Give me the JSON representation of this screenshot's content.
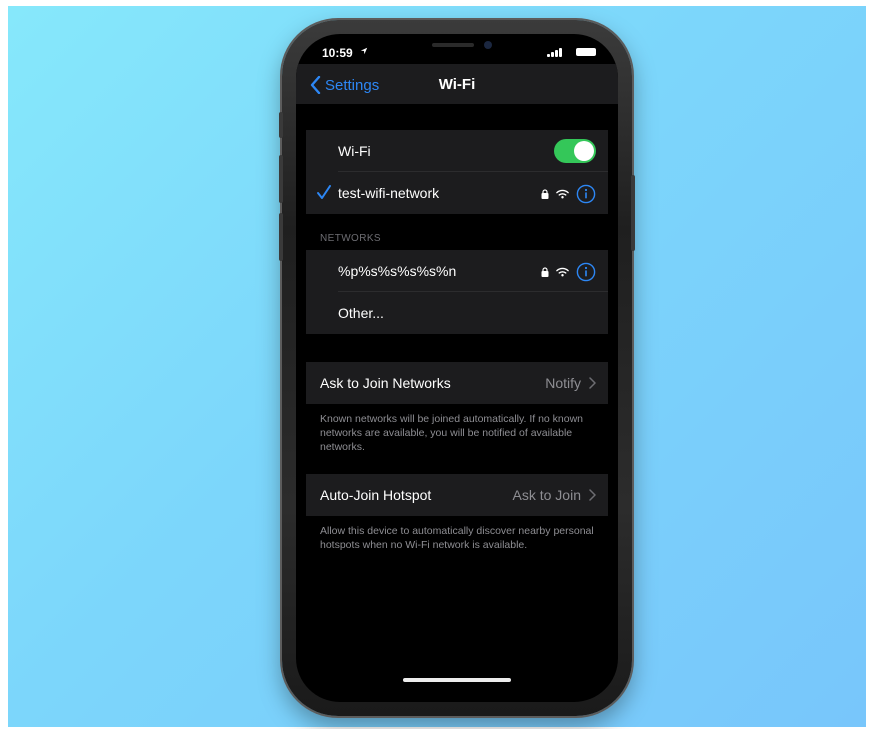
{
  "status": {
    "time": "10:59"
  },
  "nav": {
    "back_label": "Settings",
    "title": "Wi-Fi"
  },
  "wifi": {
    "label": "Wi-Fi",
    "enabled": true,
    "connected_network": "test-wifi-network"
  },
  "networks": {
    "header": "NETWORKS",
    "items": [
      {
        "name": "%p%s%s%s%s%n",
        "secured": true
      },
      {
        "name": "Other..."
      }
    ]
  },
  "ask_to_join": {
    "label": "Ask to Join Networks",
    "value": "Notify",
    "footer": "Known networks will be joined automatically. If no known networks are available, you will be notified of available networks."
  },
  "auto_join": {
    "label": "Auto-Join Hotspot",
    "value": "Ask to Join",
    "footer": "Allow this device to automatically discover nearby personal hotspots when no Wi-Fi network is available."
  },
  "colors": {
    "accent": "#2d87f5",
    "toggle_on": "#34c759",
    "background_gradient_start": "#86e8fb",
    "background_gradient_end": "#78c6fb",
    "cell_background": "#1c1c1e"
  },
  "icons": {
    "lock": "lock-icon",
    "wifi": "wifi-icon",
    "info": "info-icon",
    "check": "checkmark-icon",
    "chevron": "chevron-right-icon",
    "back": "chevron-left-icon"
  }
}
